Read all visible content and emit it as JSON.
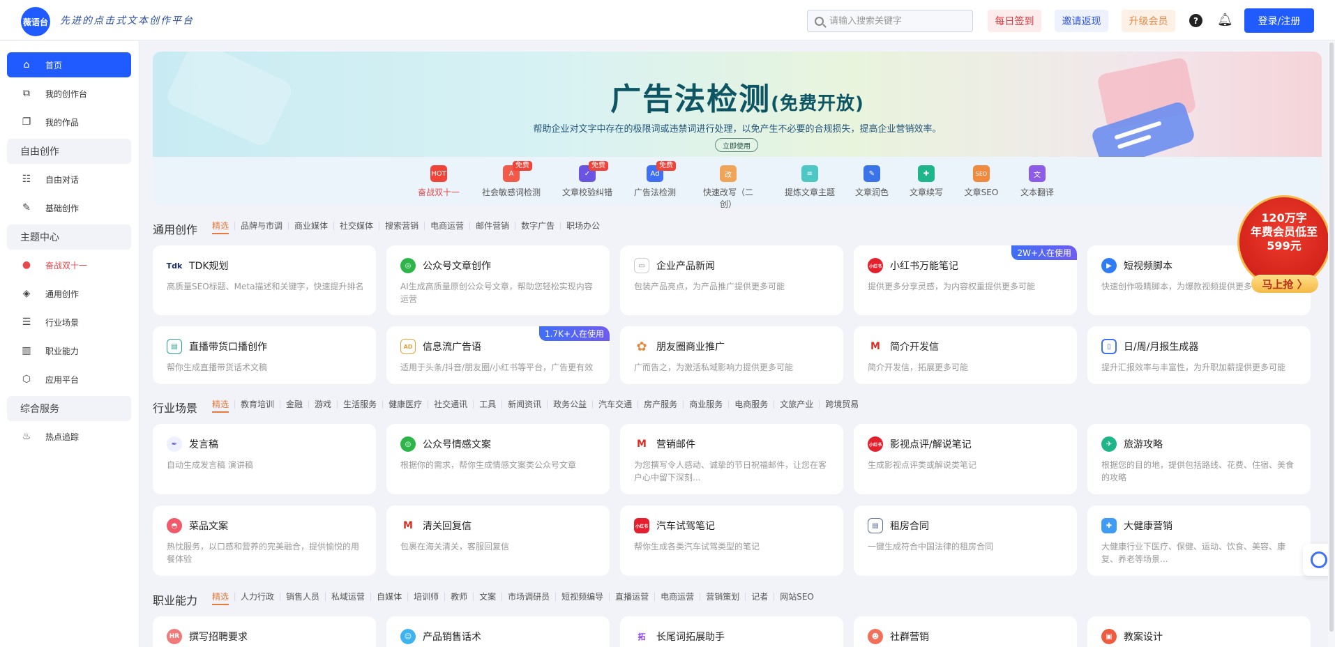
{
  "header": {
    "logo_text": "薇语台",
    "slogan": "先进的点击式文本创作平台",
    "search_placeholder": "请输入搜索关键字",
    "checkin": "每日签到",
    "invite": "邀请返现",
    "vip": "升级会员",
    "help": "?",
    "login": "登录/注册"
  },
  "sidebar": {
    "home": "首页",
    "my_workspace": "我的创作台",
    "my_works": "我的作品",
    "sec_free": "自由创作",
    "free_chat": "自由对话",
    "basic_create": "基础创作",
    "sec_theme": "主题中心",
    "double11": "奋战双十一",
    "general": "通用创作",
    "industry": "行业场景",
    "career": "职业能力",
    "apps": "应用平台",
    "sec_service": "综合服务",
    "hot": "热点追踪"
  },
  "banner": {
    "title": "广告法检测",
    "title_sub": "(免费开放)",
    "desc": "帮助企业对文字中存在的极限词或违禁词进行处理，以免产生不必要的合规损失，提高企业营销效率。",
    "button": "立即使用"
  },
  "tools": [
    {
      "label": "奋战双十一",
      "icon": "HOT",
      "free": ""
    },
    {
      "label": "社会敏感词检测",
      "icon": "A",
      "free": "免费"
    },
    {
      "label": "文章校验纠错",
      "icon": "✓",
      "free": "免费"
    },
    {
      "label": "广告法检测",
      "icon": "Ad",
      "free": "免费"
    },
    {
      "label": "快速改写（二创）",
      "icon": "改",
      "free": ""
    },
    {
      "label": "提炼文章主题",
      "icon": "≡",
      "free": ""
    },
    {
      "label": "文章润色",
      "icon": "✎",
      "free": ""
    },
    {
      "label": "文章续写",
      "icon": "✚",
      "free": ""
    },
    {
      "label": "文章SEO",
      "icon": "SEO",
      "free": ""
    },
    {
      "label": "文本翻译",
      "icon": "文",
      "free": ""
    }
  ],
  "colors": {
    "primary": "#1f5bff",
    "accent_orange": "#e87a3b",
    "red": "#e5484d"
  },
  "sections": {
    "general": {
      "title": "通用创作",
      "tabs": [
        "精选",
        "品牌与市调",
        "商业媒体",
        "社交媒体",
        "搜索营销",
        "电商运营",
        "邮件营销",
        "数字广告",
        "职场办公"
      ],
      "cards": [
        {
          "title": "TDK规划",
          "desc": "高质量SEO标题、Meta描述和关键字，快速提升排名",
          "icon": "Tdk",
          "badge": ""
        },
        {
          "title": "公众号文章创作",
          "desc": "AI生成高质量原创公众号文章，帮助您轻松实现内容运营",
          "icon": "◎",
          "badge": ""
        },
        {
          "title": "企业产品新闻",
          "desc": "包装产品亮点，为产品推广提供更多可能",
          "icon": "▭",
          "badge": ""
        },
        {
          "title": "小红书万能笔记",
          "desc": "提供更多分享灵感，为内容权重提供更多可能",
          "icon": "小红书",
          "badge": "2W+人在使用"
        },
        {
          "title": "短视频脚本",
          "desc": "快速创作吸睛脚本，为爆款视频提供更多可能",
          "icon": "▶",
          "badge": ""
        },
        {
          "title": "直播带货口播创作",
          "desc": "帮你生成直播带货话术文稿",
          "icon": "▤",
          "badge": ""
        },
        {
          "title": "信息流广告语",
          "desc": "适用于头条/抖音/朋友圈/小红书等平台，广告更有效",
          "icon": "AD",
          "badge": "1.7K+人在使用"
        },
        {
          "title": "朋友圈商业推广",
          "desc": "广而告之，为激活私域影响力提供更多可能",
          "icon": "✿",
          "badge": ""
        },
        {
          "title": "简介开发信",
          "desc": "简介开发信，拓展更多可能",
          "icon": "M",
          "badge": ""
        },
        {
          "title": "日/周/月报生成器",
          "desc": "提升汇报效率与丰富性，为升职加薪提供更多可能",
          "icon": "▯",
          "badge": ""
        }
      ]
    },
    "industry": {
      "title": "行业场景",
      "tabs": [
        "精选",
        "教育培训",
        "金融",
        "游戏",
        "生活服务",
        "健康医疗",
        "社交通讯",
        "工具",
        "新闻资讯",
        "政务公益",
        "汽车交通",
        "房产服务",
        "商业服务",
        "电商服务",
        "文旅产业",
        "跨境贸易"
      ],
      "cards": [
        {
          "title": "发言稿",
          "desc": "自动生成发言稿 演讲稿",
          "icon": "✒"
        },
        {
          "title": "公众号情感文案",
          "desc": "根据你的需求，帮你生成情感文案类公众号文章",
          "icon": "◎"
        },
        {
          "title": "营销邮件",
          "desc": "为您撰写令人感动、诚挚的节日祝福邮件，让您在客户心中留下深刻...",
          "icon": "M"
        },
        {
          "title": "影视点评/解说笔记",
          "desc": "生成影视点评类或解说类笔记",
          "icon": "小红书"
        },
        {
          "title": "旅游攻略",
          "desc": "根据您的目的地，提供包括路线、花费、住宿、美食的攻略",
          "icon": "✈"
        },
        {
          "title": "菜品文案",
          "desc": "热忱服务，以口感和营养的完美融合，提供愉悦的用餐体验",
          "icon": "◓"
        },
        {
          "title": "清关回复信",
          "desc": "包裹在海关清关，客服回复信",
          "icon": "M"
        },
        {
          "title": "汽车试驾笔记",
          "desc": "帮你生成各类汽车试驾类型的笔记",
          "icon": "小红书"
        },
        {
          "title": "租房合同",
          "desc": "一键生成符合中国法律的租房合同",
          "icon": "▤"
        },
        {
          "title": "大健康营销",
          "desc": "大健康行业下医疗、保健、运动、饮食、美容、康复、养老等场景...",
          "icon": "✚"
        }
      ]
    },
    "career": {
      "title": "职业能力",
      "tabs": [
        "精选",
        "人力行政",
        "销售人员",
        "私域运营",
        "自媒体",
        "培训师",
        "教师",
        "文案",
        "市场调研员",
        "短视频编导",
        "直播运营",
        "电商运营",
        "营销策划",
        "记者",
        "网站SEO"
      ],
      "cards": [
        {
          "title": "撰写招聘要求",
          "icon": "HR"
        },
        {
          "title": "产品销售话术",
          "icon": "☺"
        },
        {
          "title": "长尾词拓展助手",
          "icon": "拓"
        },
        {
          "title": "社群营销",
          "icon": "☻"
        },
        {
          "title": "教案设计",
          "icon": "▣"
        }
      ]
    }
  },
  "promo": {
    "line1": "120万字",
    "line2": "年费会员低至",
    "line3": "599元",
    "cta": "马上抢 〉"
  }
}
